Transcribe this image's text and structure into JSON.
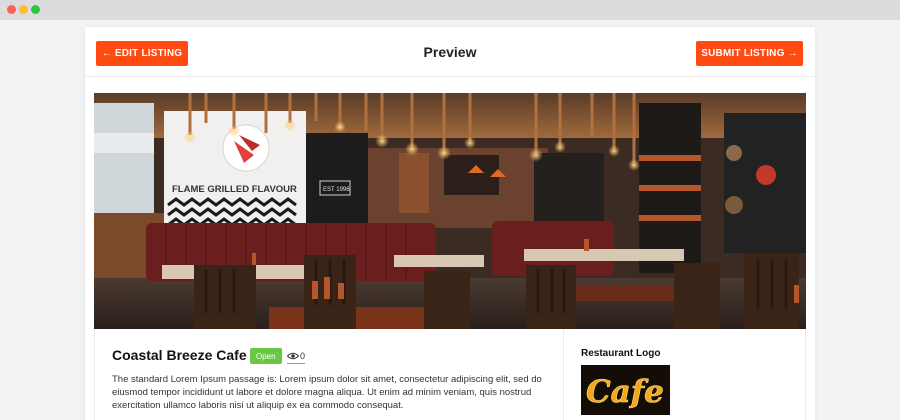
{
  "window": {
    "controls": [
      "close",
      "minimize",
      "maximize"
    ]
  },
  "toolbar": {
    "edit_label": "← EDIT LISTING",
    "title": "Preview",
    "submit_label": "SUBMIT LISTING →"
  },
  "hero": {
    "sign_text": "FLAME GRILLED FLAVOUR",
    "plaque_text": "EST 1996"
  },
  "listing": {
    "name": "Coastal Breeze Cafe",
    "status": "Open",
    "views": "0",
    "description": "The standard Lorem Ipsum passage is: Lorem ipsum dolor sit amet, consectetur adipiscing elit, sed do eiusmod tempor incididunt ut labore et dolore magna aliqua. Ut enim ad minim veniam, quis nostrud exercitation ullamco laboris nisi ut aliquip ex ea commodo consequat."
  },
  "logo_panel": {
    "title": "Restaurant Logo",
    "logo_text": "Cafe"
  },
  "colors": {
    "accent": "#ff4a12",
    "status_open": "#6ac744"
  }
}
